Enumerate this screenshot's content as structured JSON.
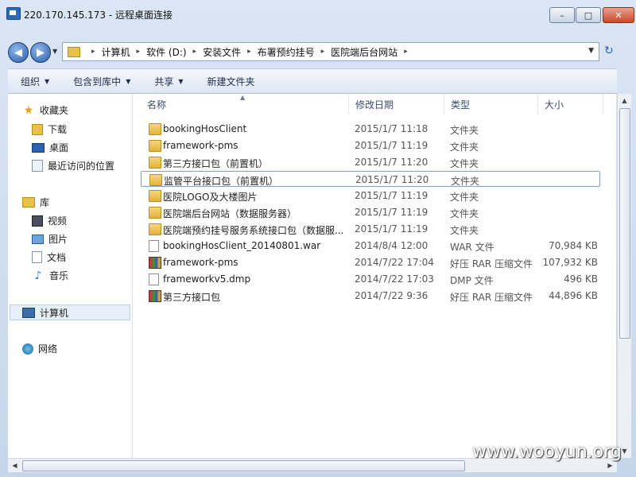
{
  "window": {
    "title": "220.170.145.173 - 远程桌面连接",
    "minimize": "–",
    "maximize": "□",
    "close": "✕"
  },
  "nav": {
    "back_icon": "◀",
    "forward_icon": "▶",
    "dropdown": "▼",
    "refresh": "↻"
  },
  "address": {
    "breadcrumbs": [
      "计算机",
      "软件 (D:)",
      "安装文件",
      "布署预约挂号",
      "医院端后台网站"
    ],
    "separator": "▸",
    "dropdown": "▼"
  },
  "toolbar": {
    "organize": "组织",
    "include_library": "包含到库中",
    "share": "共享",
    "new_folder": "新建文件夹",
    "arrow": "▼"
  },
  "sidebar": {
    "favorites": "收藏夹",
    "downloads": "下载",
    "desktop": "桌面",
    "recent": "最近访问的位置",
    "libraries": "库",
    "videos": "视频",
    "pictures": "图片",
    "documents": "文档",
    "music": "音乐",
    "computer": "计算机",
    "network": "网络"
  },
  "columns": {
    "name": "名称",
    "date": "修改日期",
    "type": "类型",
    "size": "大小",
    "sort_arrow": "▲"
  },
  "files": [
    {
      "name": "bookingHosClient",
      "date": "2015/1/7 11:18",
      "type": "文件夹",
      "size": "",
      "icon": "folder"
    },
    {
      "name": "framework-pms",
      "date": "2015/1/7 11:19",
      "type": "文件夹",
      "size": "",
      "icon": "folder"
    },
    {
      "name": "第三方接口包（前置机）",
      "date": "2015/1/7 11:20",
      "type": "文件夹",
      "size": "",
      "icon": "folder"
    },
    {
      "name": "监管平台接口包（前置机）",
      "date": "2015/1/7 11:20",
      "type": "文件夹",
      "size": "",
      "icon": "folder"
    },
    {
      "name": "医院LOGO及大楼图片",
      "date": "2015/1/7 11:19",
      "type": "文件夹",
      "size": "",
      "icon": "folder"
    },
    {
      "name": "医院端后台网站（数据服务器）",
      "date": "2015/1/7 11:19",
      "type": "文件夹",
      "size": "",
      "icon": "folder"
    },
    {
      "name": "医院端预约挂号服务系统接口包（数据服...",
      "date": "2015/1/7 11:19",
      "type": "文件夹",
      "size": "",
      "icon": "folder"
    },
    {
      "name": "bookingHosClient_20140801.war",
      "date": "2014/8/4 12:00",
      "type": "WAR 文件",
      "size": "70,984 KB",
      "icon": "file"
    },
    {
      "name": "framework-pms",
      "date": "2014/7/22 17:04",
      "type": "好压 RAR 压缩文件",
      "size": "107,932 KB",
      "icon": "rar"
    },
    {
      "name": "frameworkv5.dmp",
      "date": "2014/7/22 17:03",
      "type": "DMP 文件",
      "size": "496 KB",
      "icon": "file"
    },
    {
      "name": "第三方接口包",
      "date": "2014/7/22 9:36",
      "type": "好压 RAR 压缩文件",
      "size": "44,896 KB",
      "icon": "rar"
    }
  ],
  "selected_index": 3,
  "scroll": {
    "up": "▲",
    "down": "▼",
    "left": "◀",
    "right": "▶"
  },
  "watermark": "www.wooyun.org"
}
